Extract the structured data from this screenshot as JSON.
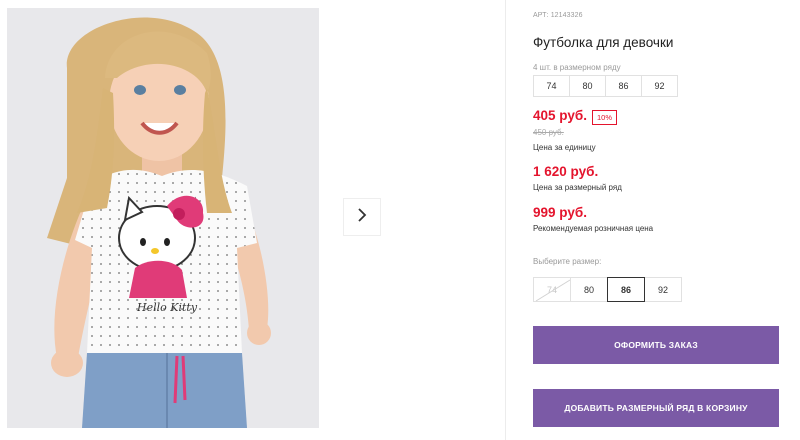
{
  "gallery": {
    "image_alt": "Футболка для девочки — фото",
    "print_text": "Hello Kitty",
    "next_icon": "chevron-right-icon"
  },
  "product": {
    "sku": "АРТ: 12143326",
    "title": "Футболка для девочки",
    "pack_note": "4 шт. в размерном ряду",
    "pack_sizes": [
      "74",
      "80",
      "86",
      "92"
    ]
  },
  "pricing": {
    "unit_price": "405 руб.",
    "discount": "10%",
    "old_price": "450 руб.",
    "unit_caption": "Цена за единицу",
    "pack_price": "1 620 руб.",
    "pack_caption": "Цена за размерный ряд",
    "rrp_price": "999 руб.",
    "rrp_caption": "Рекомендуемая розничная цена"
  },
  "size_picker": {
    "label": "Выберите размер:",
    "options": [
      {
        "label": "74",
        "state": "unavailable"
      },
      {
        "label": "80",
        "state": "available"
      },
      {
        "label": "86",
        "state": "selected"
      },
      {
        "label": "92",
        "state": "available"
      }
    ]
  },
  "actions": {
    "order_label": "ОФОРМИТЬ ЗАКАЗ",
    "cart_label": "ДОБАВИТЬ РАЗМЕРНЫЙ РЯД В КОРЗИНУ"
  },
  "colors": {
    "accent_purple": "#7b5aa6",
    "price_red": "#e4142d"
  }
}
